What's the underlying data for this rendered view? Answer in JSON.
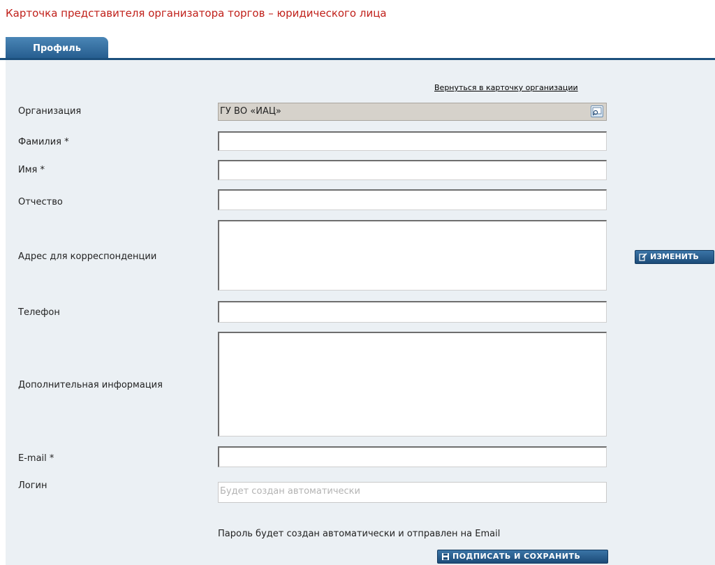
{
  "page_title": "Карточка представителя организатора торгов – юридического лица",
  "tabs": [
    {
      "label": "Профиль",
      "active": true
    }
  ],
  "back_link": "Вернуться в карточку организации",
  "form": {
    "organization": {
      "label": "Организация",
      "value": "ГУ ВО «ИАЦ»"
    },
    "last_name": {
      "label": "Фамилия *",
      "value": ""
    },
    "first_name": {
      "label": "Имя *",
      "value": ""
    },
    "patronymic": {
      "label": "Отчество",
      "value": ""
    },
    "address": {
      "label": "Адрес для корреспонденции",
      "value": ""
    },
    "phone": {
      "label": "Телефон",
      "value": ""
    },
    "additional_info": {
      "label": "Дополнительная информация",
      "value": ""
    },
    "email": {
      "label": "E-mail *",
      "value": ""
    },
    "login": {
      "label": "Логин",
      "placeholder": "Будет создан автоматически"
    }
  },
  "buttons": {
    "edit": "ИЗМЕНИТЬ",
    "save": "ПОДПИСАТЬ И СОХРАНИТЬ"
  },
  "password_note": "Пароль будет создан автоматически и отправлен на Email",
  "icons": {
    "lookup": "magnifier-lookup-icon",
    "edit": "edit-pencil-icon",
    "save": "floppy-disk-icon"
  },
  "colors": {
    "title": "#c0201a",
    "tab": "#235a8c",
    "content_background": "#ebf0f4",
    "button": "#1c4b78"
  }
}
